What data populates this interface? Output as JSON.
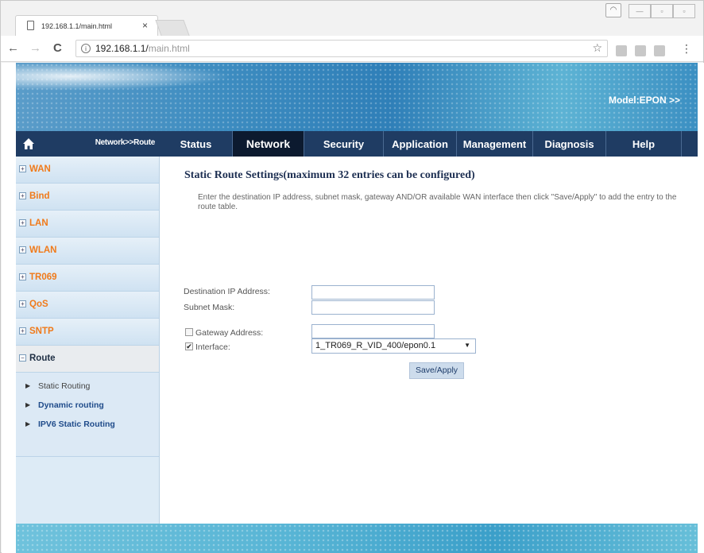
{
  "browser": {
    "tab_title": "192.168.1.1/main.html",
    "tab_close": "×",
    "url_host": "192.168.1.1/",
    "url_path": "main.html",
    "info_icon": "i",
    "star_icon": "☆",
    "menu_icon": "⋮",
    "back_icon": "←",
    "forward_icon": "→",
    "reload_icon": "C"
  },
  "banner": {
    "model_label": "Model:EPON >>"
  },
  "side_header": {
    "breadcrumb": "Network>>Route"
  },
  "nav": {
    "tabs": [
      {
        "label": "Status"
      },
      {
        "label": "Network"
      },
      {
        "label": "Security"
      },
      {
        "label": "Application"
      },
      {
        "label": "Management"
      },
      {
        "label": "Diagnosis"
      },
      {
        "label": "Help"
      }
    ],
    "active": "Network"
  },
  "sidebar": {
    "items": [
      {
        "label": "WAN",
        "toggle": "+"
      },
      {
        "label": "Bind",
        "toggle": "+"
      },
      {
        "label": "LAN",
        "toggle": "+"
      },
      {
        "label": "WLAN",
        "toggle": "+"
      },
      {
        "label": "TR069",
        "toggle": "+"
      },
      {
        "label": "QoS",
        "toggle": "+"
      },
      {
        "label": "SNTP",
        "toggle": "+"
      },
      {
        "label": "Route",
        "toggle": "−"
      }
    ],
    "sub_items": [
      {
        "label": "Static Routing",
        "arrow": "▶"
      },
      {
        "label": "Dynamic routing",
        "arrow": "▶"
      },
      {
        "label": "IPV6 Static Routing",
        "arrow": "▶"
      }
    ]
  },
  "content": {
    "title": "Static Route Settings(maximum 32 entries can be configured)",
    "description": "Enter the destination IP address, subnet mask, gateway AND/OR available WAN interface then click \"Save/Apply\" to add the entry to the route table.",
    "dest_ip_label": "Destination IP Address:",
    "dest_ip_value": "",
    "subnet_label": "Subnet Mask:",
    "subnet_value": "",
    "gateway_label": "Gateway Address:",
    "gateway_checked": false,
    "gateway_value": "",
    "interface_label": "Interface:",
    "interface_checked": true,
    "interface_check_mark": "✔",
    "interface_value": "1_TR069_R_VID_400/epon0.1",
    "select_arrow": "▼",
    "apply_label": "Save/Apply"
  },
  "colors": {
    "nav_bg": "#1f3c63",
    "nav_active": "#0c1a2f",
    "sidebar_label": "#f07a1a",
    "title": "#1d2f52"
  }
}
